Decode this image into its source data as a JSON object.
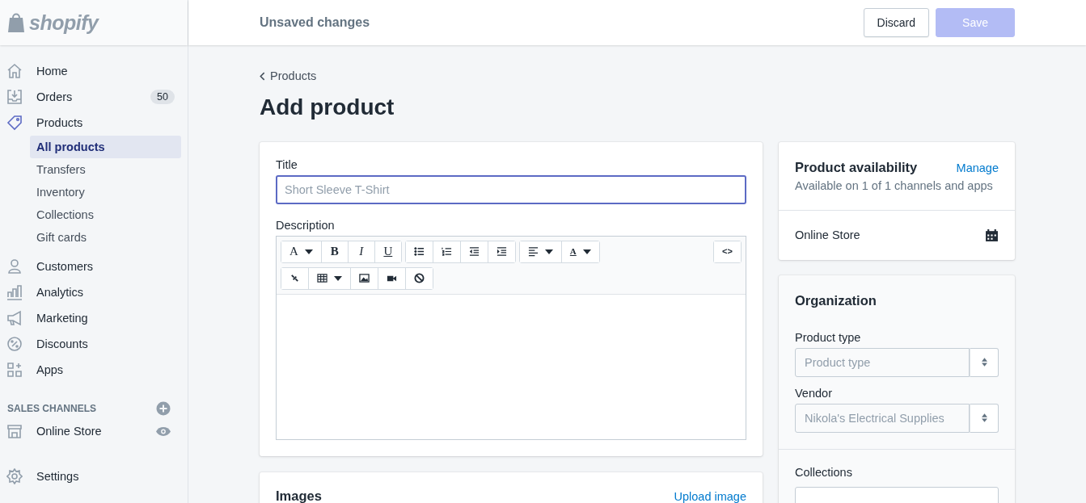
{
  "logo": {
    "text": "shopify"
  },
  "topbar": {
    "title": "Unsaved changes",
    "buttons": [
      {
        "label": "Discard",
        "kind": "secondary",
        "disabled": false
      },
      {
        "label": "Save",
        "kind": "primary",
        "disabled": true
      }
    ]
  },
  "sidebar": {
    "items": [
      {
        "label": "Home",
        "selected": false
      },
      {
        "label": "Orders",
        "badge": "50",
        "selected": false
      },
      {
        "label": "Products",
        "selected": true,
        "children": [
          {
            "label": "All products",
            "selected": true
          },
          {
            "label": "Transfers",
            "selected": false
          },
          {
            "label": "Inventory",
            "selected": false
          },
          {
            "label": "Collections",
            "selected": false
          },
          {
            "label": "Gift cards",
            "selected": false
          }
        ]
      },
      {
        "label": "Customers",
        "selected": false
      },
      {
        "label": "Analytics",
        "selected": false
      },
      {
        "label": "Marketing",
        "selected": false
      },
      {
        "label": "Discounts",
        "selected": false
      },
      {
        "label": "Apps",
        "selected": false
      }
    ],
    "channels_heading": "SALES CHANNELS",
    "channels": [
      {
        "label": "Online Store",
        "selected": false
      }
    ],
    "settings": {
      "label": "Settings",
      "selected": false
    }
  },
  "breadcrumb": "Products",
  "page_title": "Add product",
  "product_card": {
    "title_label": "Title",
    "title_placeholder": "Short Sleeve T-Shirt",
    "description_label": "Description",
    "toolbar": [
      [
        {
          "kind": "font",
          "label": "A",
          "dropdown": true
        },
        {
          "kind": "bold",
          "label": "B"
        },
        {
          "kind": "italic",
          "label": "I"
        },
        {
          "kind": "underline",
          "label": "U"
        }
      ],
      [
        {
          "kind": "bullets"
        },
        {
          "kind": "numbers"
        },
        {
          "kind": "outdent"
        },
        {
          "kind": "indent"
        }
      ],
      [
        {
          "kind": "align",
          "dropdown": true
        },
        {
          "kind": "color",
          "label": "A",
          "dropdown": true
        }
      ],
      [
        {
          "kind": "code",
          "label": "<>"
        }
      ],
      [
        {
          "kind": "link"
        },
        {
          "kind": "table",
          "dropdown": true
        },
        {
          "kind": "image"
        },
        {
          "kind": "video"
        },
        {
          "kind": "clear"
        }
      ]
    ]
  },
  "images_card": {
    "title": "Images",
    "action": "Upload image"
  },
  "availability": {
    "title": "Product availability",
    "action": "Manage",
    "subtitle": "Available on 1 of 1 channels and apps",
    "channels": [
      {
        "name": "Online Store"
      }
    ]
  },
  "organization": {
    "title": "Organization",
    "fields": [
      {
        "label": "Product type",
        "placeholder": "Product type"
      },
      {
        "label": "Vendor",
        "placeholder": "Nikola's Electrical Supplies"
      }
    ],
    "collections_label": "Collections"
  }
}
